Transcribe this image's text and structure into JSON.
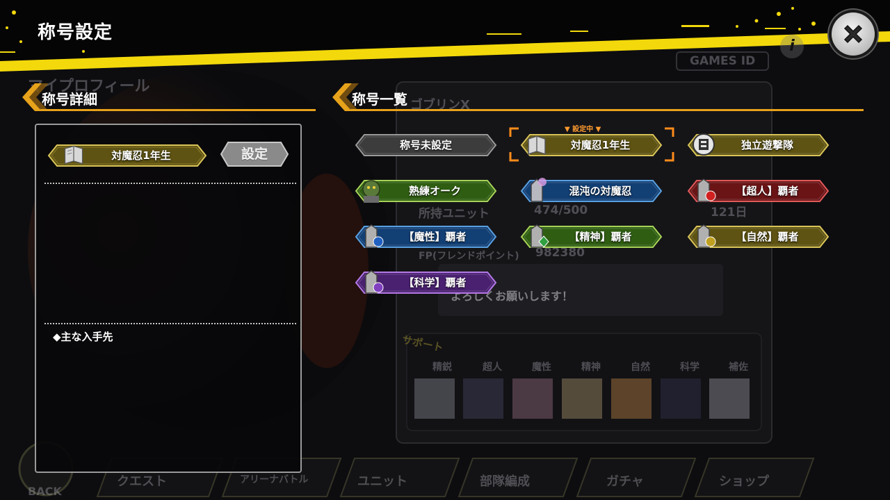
{
  "header": {
    "title": "称号設定"
  },
  "close_button": {
    "icon": "close-x-icon"
  },
  "detail_section": {
    "header": "称号詳細"
  },
  "list_section": {
    "header": "称号一覧"
  },
  "detail": {
    "selected_title": "対魔忍1年生",
    "set_button": "設定",
    "acquisition_label": "◆主な入手先"
  },
  "titles": [
    {
      "label": "称号未設定",
      "style": "none",
      "icon": ""
    },
    {
      "label": "対魔忍1年生",
      "style": "gold",
      "icon": "book-icon",
      "equipped": true
    },
    {
      "label": "独立遊撃隊",
      "style": "gold",
      "icon": "squad-emblem-icon"
    },
    {
      "label": "熟練オーク",
      "style": "green",
      "icon": "orc-icon"
    },
    {
      "label": "混沌の対魔忍",
      "style": "blue",
      "icon": "chaos-pillar-icon"
    },
    {
      "label": "【超人】覇者",
      "style": "red",
      "icon": "superhuman-element-icon"
    },
    {
      "label": "【魔性】覇者",
      "style": "blue",
      "icon": "demonic-element-icon"
    },
    {
      "label": "【精神】覇者",
      "style": "green",
      "icon": "spirit-element-icon"
    },
    {
      "label": "【自然】覇者",
      "style": "gold",
      "icon": "nature-element-icon"
    },
    {
      "label": "【科学】覇者",
      "style": "purple",
      "icon": "science-element-icon"
    }
  ],
  "equipped_tag": "▼ 設定中 ▼",
  "colors": {
    "accent_yellow": "#f3d90b",
    "gold": "#6b5d14",
    "green": "#2f5e12",
    "blue": "#123f74",
    "red": "#6a1416",
    "purple": "#4a2070",
    "none": "#3c3c3c",
    "equipped_frame": "#ff8c1a"
  },
  "background_text": {
    "games_id": "GAMES ID",
    "profile": "マイプロフィール",
    "player_name": "ゴブリンX",
    "units_label": "所持ユニット",
    "units_value": "474/500",
    "fp_label": "FP(フレンドポイント)",
    "fp_value": "982380",
    "comment": "よろしくお願いします！",
    "days": "121日",
    "support": "サポート",
    "attrs": [
      "精鋭",
      "超人",
      "魔性",
      "精神",
      "自然",
      "科学",
      "補佐"
    ],
    "nav": [
      "クエスト",
      "アリーナバトル",
      "ユニット",
      "部隊編成",
      "ガチャ",
      "ショップ"
    ],
    "back": "BACK"
  }
}
